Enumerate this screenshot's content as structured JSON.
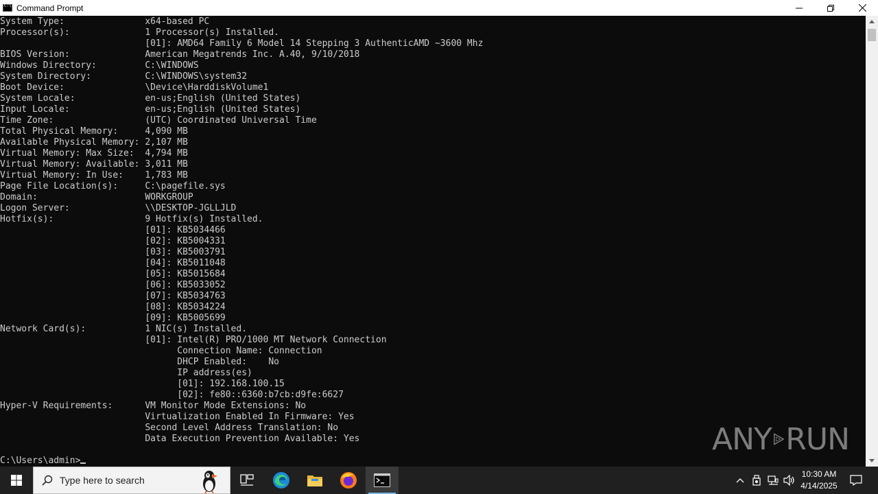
{
  "window": {
    "title": "Command Prompt"
  },
  "console": {
    "lines": [
      "System Type:               x64-based PC",
      "Processor(s):              1 Processor(s) Installed.",
      "                           [01]: AMD64 Family 6 Model 14 Stepping 3 AuthenticAMD ~3600 Mhz",
      "BIOS Version:              American Megatrends Inc. A.40, 9/10/2018",
      "Windows Directory:         C:\\WINDOWS",
      "System Directory:          C:\\WINDOWS\\system32",
      "Boot Device:               \\Device\\HarddiskVolume1",
      "System Locale:             en-us;English (United States)",
      "Input Locale:              en-us;English (United States)",
      "Time Zone:                 (UTC) Coordinated Universal Time",
      "Total Physical Memory:     4,090 MB",
      "Available Physical Memory: 2,107 MB",
      "Virtual Memory: Max Size:  4,794 MB",
      "Virtual Memory: Available: 3,011 MB",
      "Virtual Memory: In Use:    1,783 MB",
      "Page File Location(s):     C:\\pagefile.sys",
      "Domain:                    WORKGROUP",
      "Logon Server:              \\\\DESKTOP-JGLLJLD",
      "Hotfix(s):                 9 Hotfix(s) Installed.",
      "                           [01]: KB5034466",
      "                           [02]: KB5004331",
      "                           [03]: KB5003791",
      "                           [04]: KB5011048",
      "                           [05]: KB5015684",
      "                           [06]: KB5033052",
      "                           [07]: KB5034763",
      "                           [08]: KB5034224",
      "                           [09]: KB5005699",
      "Network Card(s):           1 NIC(s) Installed.",
      "                           [01]: Intel(R) PRO/1000 MT Network Connection",
      "                                 Connection Name: Connection",
      "                                 DHCP Enabled:    No",
      "                                 IP address(es)",
      "                                 [01]: 192.168.100.15",
      "                                 [02]: fe80::6360:b7cb:d9fe:6627",
      "Hyper-V Requirements:      VM Monitor Mode Extensions: No",
      "                           Virtualization Enabled In Firmware: Yes",
      "                           Second Level Address Translation: No",
      "                           Data Execution Prevention Available: Yes",
      ""
    ],
    "prompt": "C:\\Users\\admin>"
  },
  "watermark": {
    "left": "ANY",
    "right": "RUN"
  },
  "taskbar": {
    "search_placeholder": "Type here to search",
    "time": "10:30 AM",
    "date": "4/14/2025",
    "apps": [
      "task-view",
      "edge",
      "file-explorer",
      "firefox",
      "command-prompt"
    ]
  },
  "colors": {
    "console_bg": "#0c0c0c",
    "console_fg": "#cccccc",
    "taskbar_bg": "#202020",
    "accent": "#76b9ed"
  }
}
